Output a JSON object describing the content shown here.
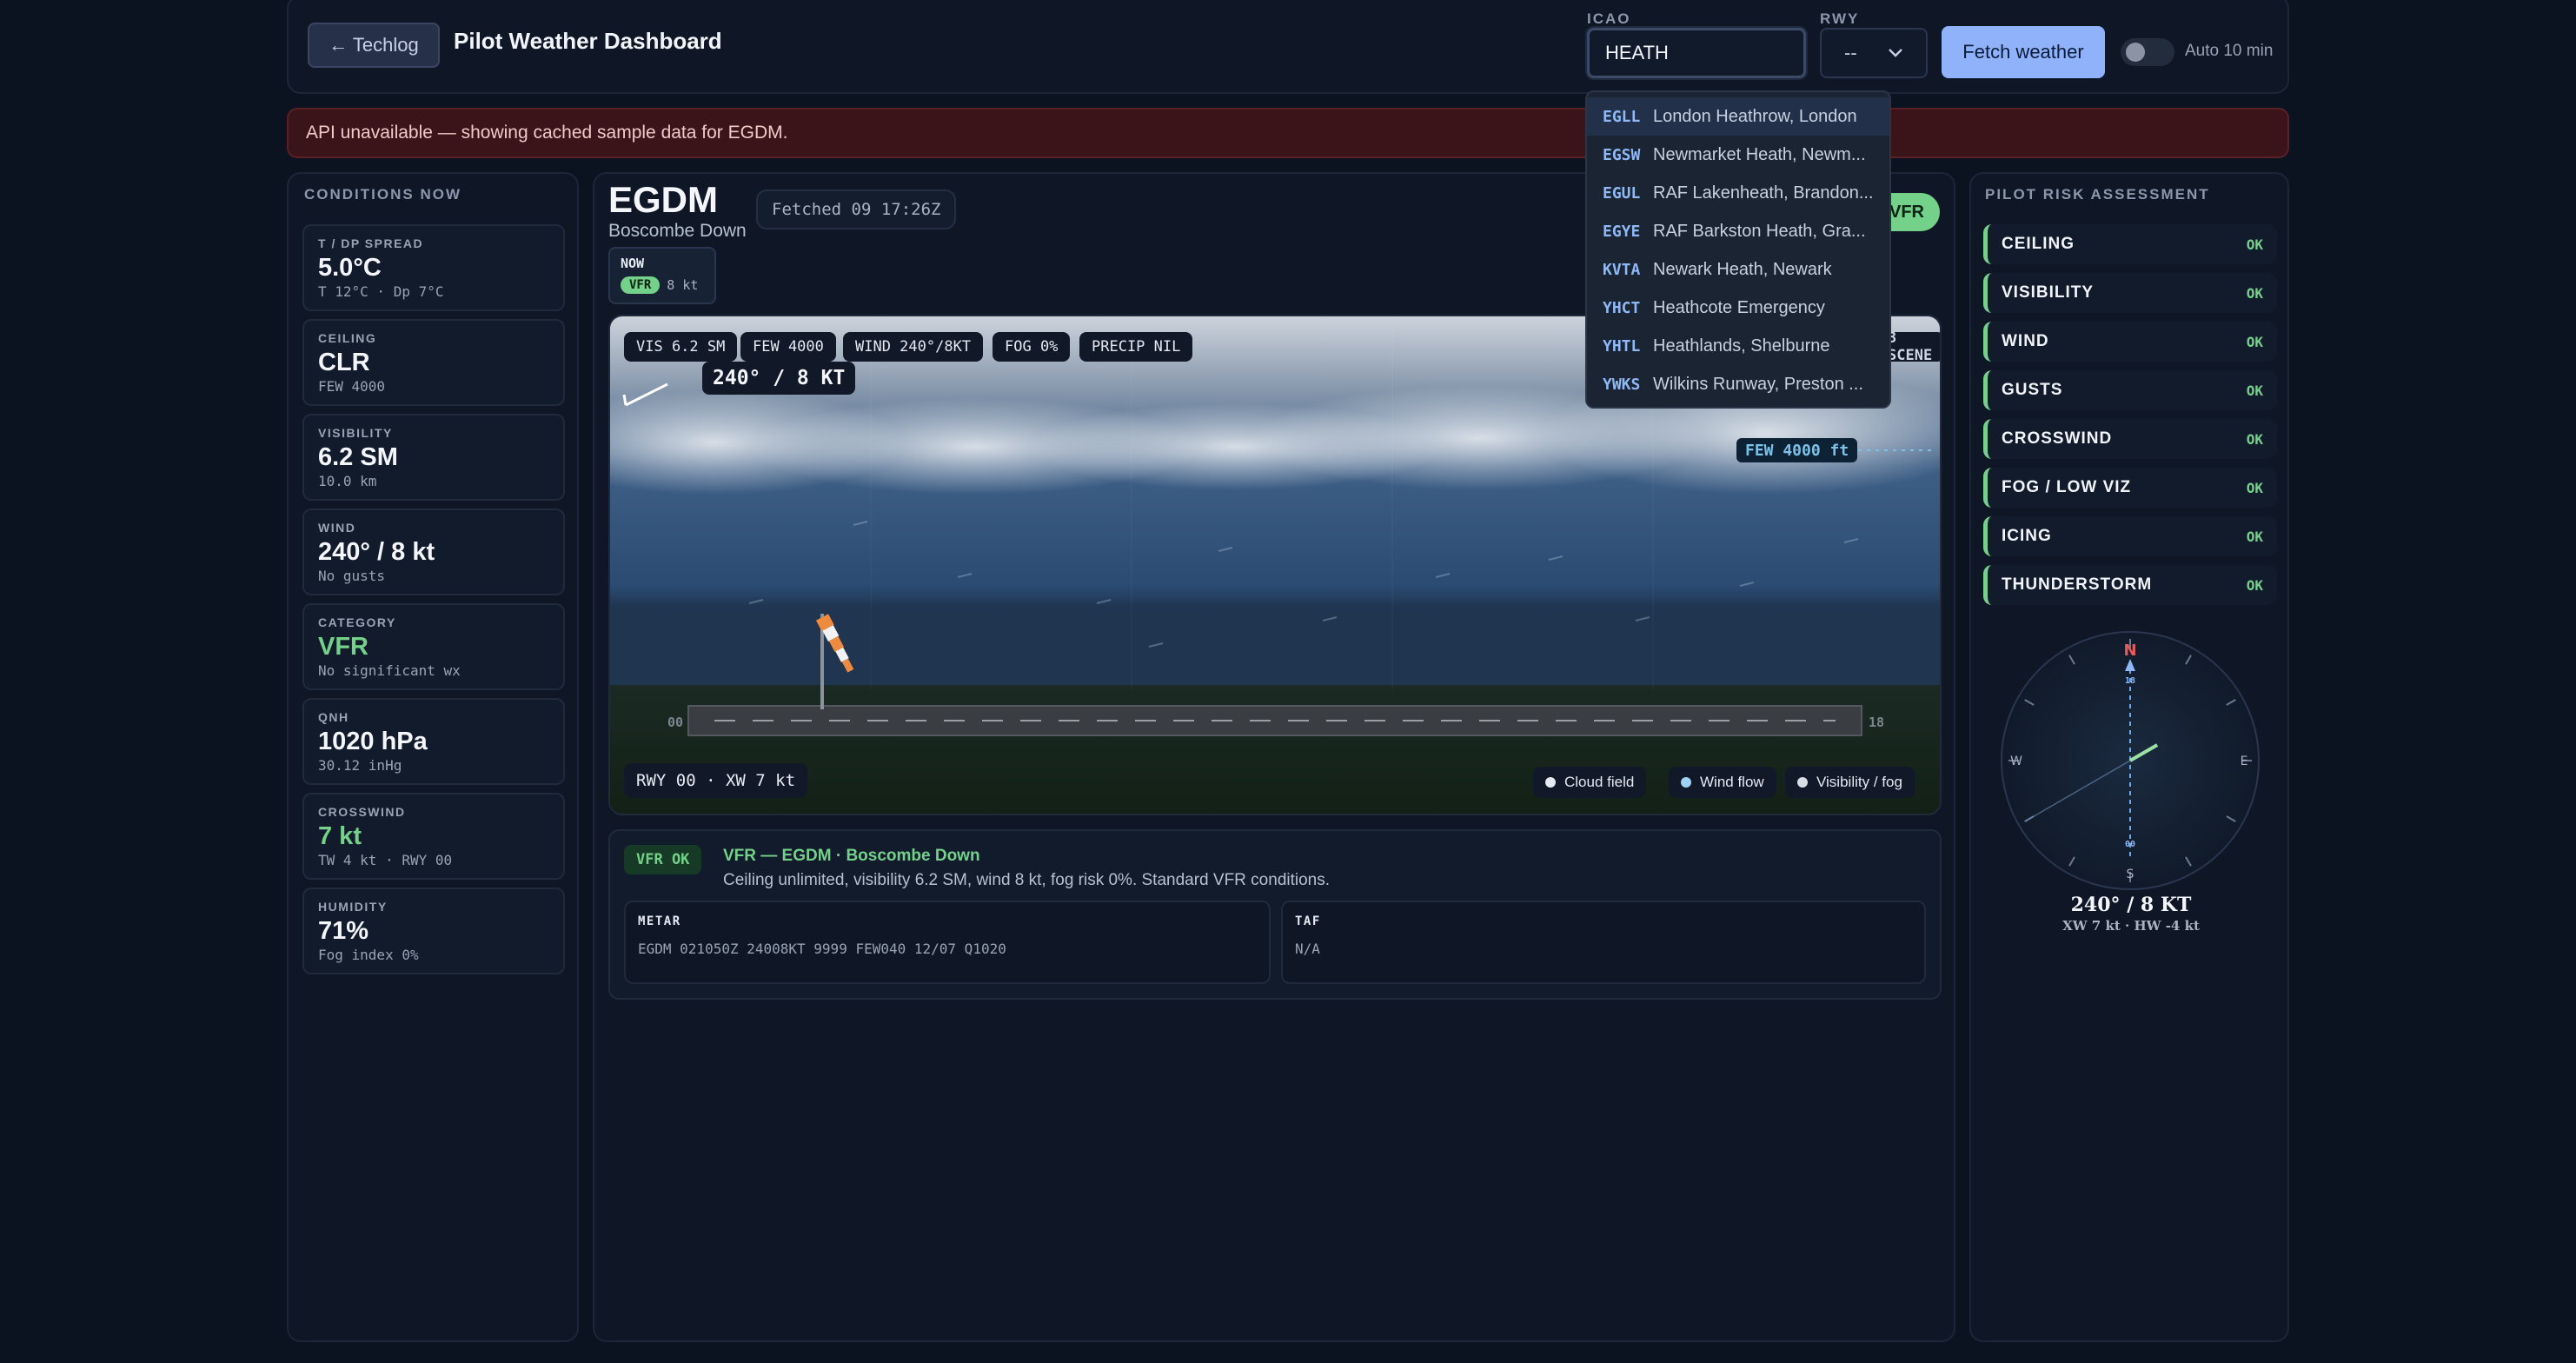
{
  "header": {
    "back_label": "← Techlog",
    "title": "Pilot Weather Dashboard",
    "icao_label": "ICAO",
    "icao_value": "HEATH",
    "rwy_label": "RWY",
    "rwy_value": "--",
    "fetch_label": "Fetch weather",
    "auto_label": "Auto 10 min"
  },
  "dropdown": [
    {
      "code": "EGLL",
      "name": "London Heathrow, London"
    },
    {
      "code": "EGSW",
      "name": "Newmarket Heath, Newm..."
    },
    {
      "code": "EGUL",
      "name": "RAF Lakenheath, Brandon..."
    },
    {
      "code": "EGYE",
      "name": "RAF Barkston Heath, Gra..."
    },
    {
      "code": "KVTA",
      "name": "Newark Heath, Newark"
    },
    {
      "code": "YHCT",
      "name": "Heathcote Emergency"
    },
    {
      "code": "YHTL",
      "name": "Heathlands, Shelburne"
    },
    {
      "code": "YWKS",
      "name": "Wilkins Runway, Preston ..."
    }
  ],
  "banner": "API unavailable — showing cached sample data for EGDM.",
  "conditions": {
    "title": "CONDITIONS NOW",
    "cards": [
      {
        "label": "T / DP SPREAD",
        "value": "5.0°C",
        "sub": "T 12°C · Dp 7°C"
      },
      {
        "label": "CEILING",
        "value": "CLR",
        "sub": "FEW 4000"
      },
      {
        "label": "VISIBILITY",
        "value": "6.2 SM",
        "sub": "10.0 km"
      },
      {
        "label": "WIND",
        "value": "240° / 8 kt",
        "sub": "No gusts"
      },
      {
        "label": "CATEGORY",
        "value": "VFR",
        "sub": "No significant wx"
      },
      {
        "label": "QNH",
        "value": "1020 hPa",
        "sub": "30.12 inHg"
      },
      {
        "label": "CROSSWIND",
        "value": "7 kt",
        "sub": "TW 4 kt · RWY 00"
      },
      {
        "label": "HUMIDITY",
        "value": "71%",
        "sub": "Fog index 0%"
      }
    ]
  },
  "station": {
    "code": "EGDM",
    "name": "Boscombe Down",
    "fetched": "Fetched 09 17:26Z",
    "category": "VFR",
    "now_label": "NOW",
    "now_category": "VFR",
    "now_wind": "8 kt"
  },
  "scene": {
    "chips": [
      "VIS 6.2 SM",
      "FEW 4000",
      "WIND 240°/8KT",
      "FOG 0%",
      "PRECIP NIL"
    ],
    "wind_label": "240° / 8 KT",
    "scene_btn": "3 SCENE",
    "cloud_tag": "FEW 4000 ft",
    "rwy_tag": "RWY 00 · XW 7 kt",
    "rwy_end_a": "00",
    "rwy_end_b": "18",
    "legend": [
      {
        "label": "Cloud field",
        "color": "#e6ebf3"
      },
      {
        "label": "Wind flow",
        "color": "#9fd3f5"
      },
      {
        "label": "Visibility / fog",
        "color": "#d8dde6"
      }
    ]
  },
  "summary": {
    "badge": "VFR OK",
    "title": "VFR — EGDM · Boscombe Down",
    "text": "Ceiling unlimited, visibility 6.2 SM, wind 8 kt, fog risk 0%. Standard VFR conditions.",
    "metar_label": "METAR",
    "metar_text": "EGDM 021050Z 24008KT 9999 FEW040 12/07 Q1020",
    "taf_label": "TAF",
    "taf_text": "N/A"
  },
  "risk": {
    "title": "PILOT RISK ASSESSMENT",
    "items": [
      {
        "name": "CEILING",
        "status": "OK"
      },
      {
        "name": "VISIBILITY",
        "status": "OK"
      },
      {
        "name": "WIND",
        "status": "OK"
      },
      {
        "name": "GUSTS",
        "status": "OK"
      },
      {
        "name": "CROSSWIND",
        "status": "OK"
      },
      {
        "name": "FOG / LOW VIZ",
        "status": "OK"
      },
      {
        "name": "ICING",
        "status": "OK"
      },
      {
        "name": "THUNDERSTORM",
        "status": "OK"
      }
    ],
    "compass": {
      "n": "N",
      "e": "E",
      "s": "S",
      "w": "W",
      "rwy_a": "18",
      "rwy_b": "00",
      "wind_dir_deg": 240,
      "main": "240° / 8 KT",
      "sub": "XW 7 kt · HW -4 kt"
    }
  },
  "colors": {
    "accent": "#8fb2fb",
    "vfr": "#74d18a",
    "background": "#0b1220",
    "alert": "#3a1418"
  }
}
